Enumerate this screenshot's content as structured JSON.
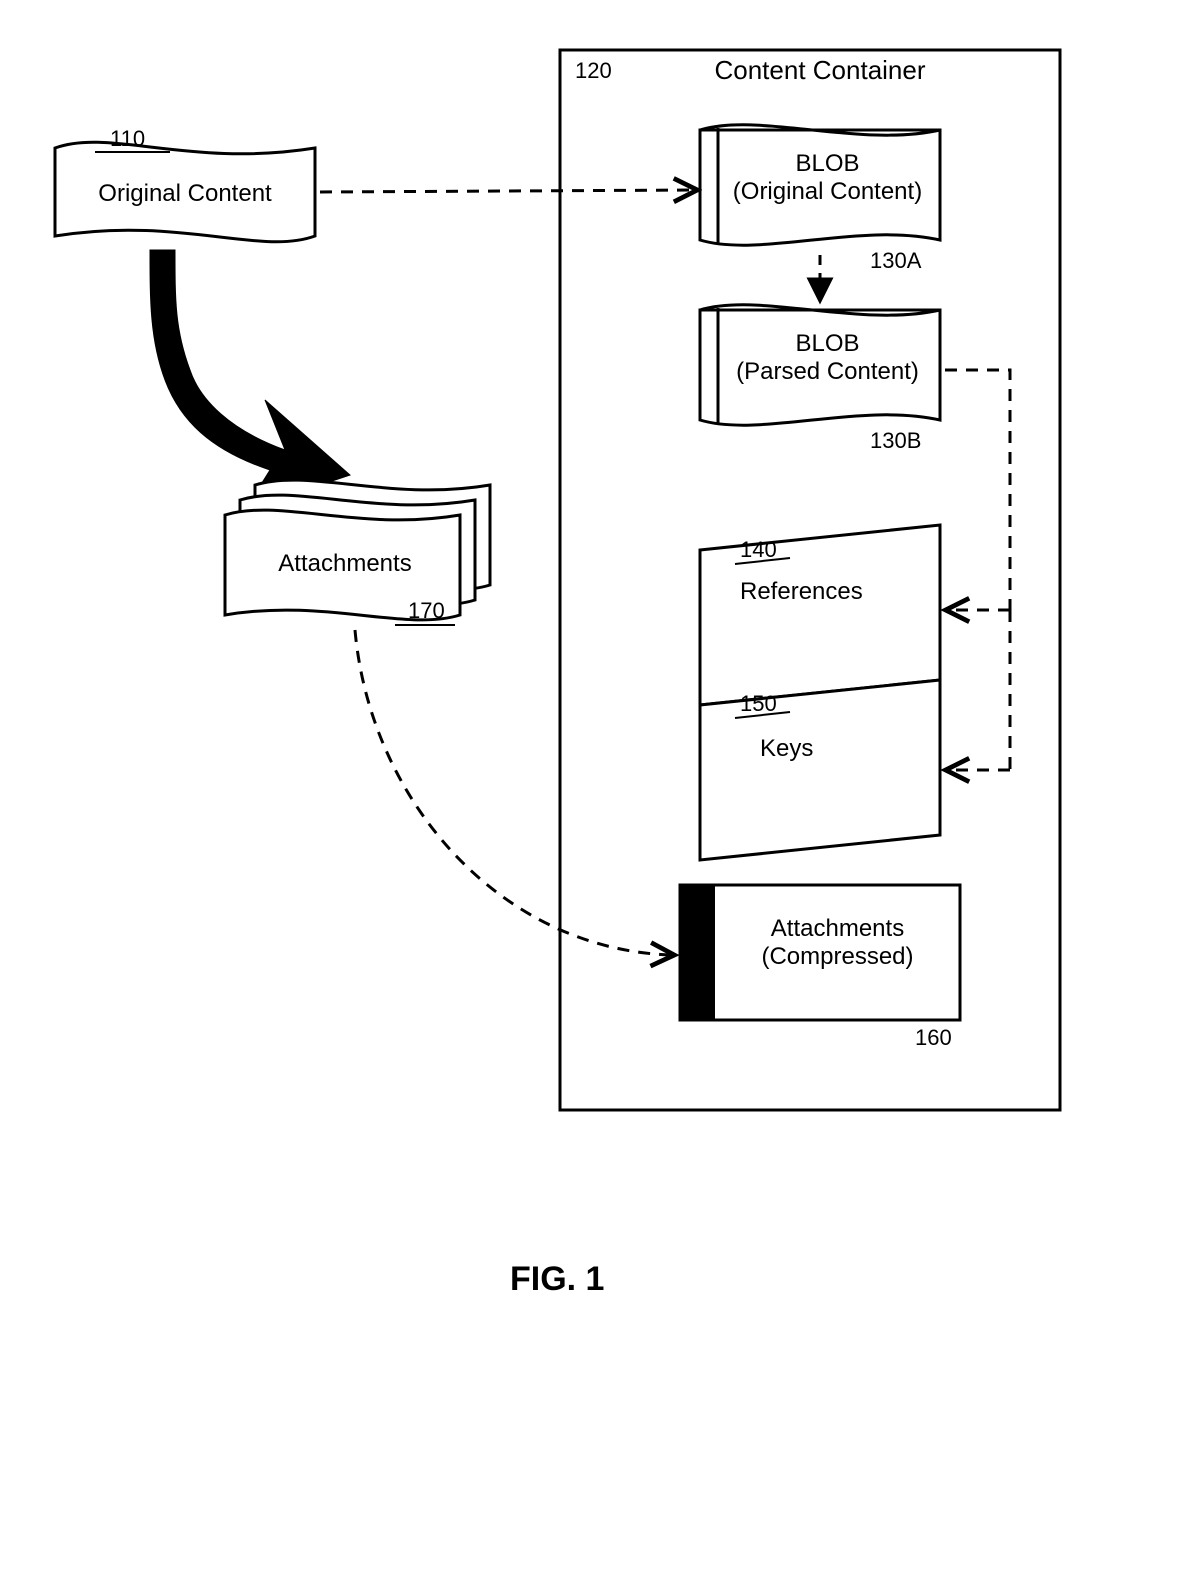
{
  "figure_label": "FIG. 1",
  "container": {
    "title": "Content Container",
    "ref": "120"
  },
  "original_content": {
    "label": "Original Content",
    "ref": "110"
  },
  "blob_original": {
    "line1": "BLOB",
    "line2": "(Original Content)",
    "ref": "130A"
  },
  "blob_parsed": {
    "line1": "BLOB",
    "line2": "(Parsed Content)",
    "ref": "130B"
  },
  "references": {
    "label": "References",
    "ref": "140"
  },
  "keys": {
    "label": "Keys",
    "ref": "150"
  },
  "attachments_compressed": {
    "line1": "Attachments",
    "line2": "(Compressed)",
    "ref": "160"
  },
  "attachments": {
    "label": "Attachments",
    "ref": "170"
  }
}
